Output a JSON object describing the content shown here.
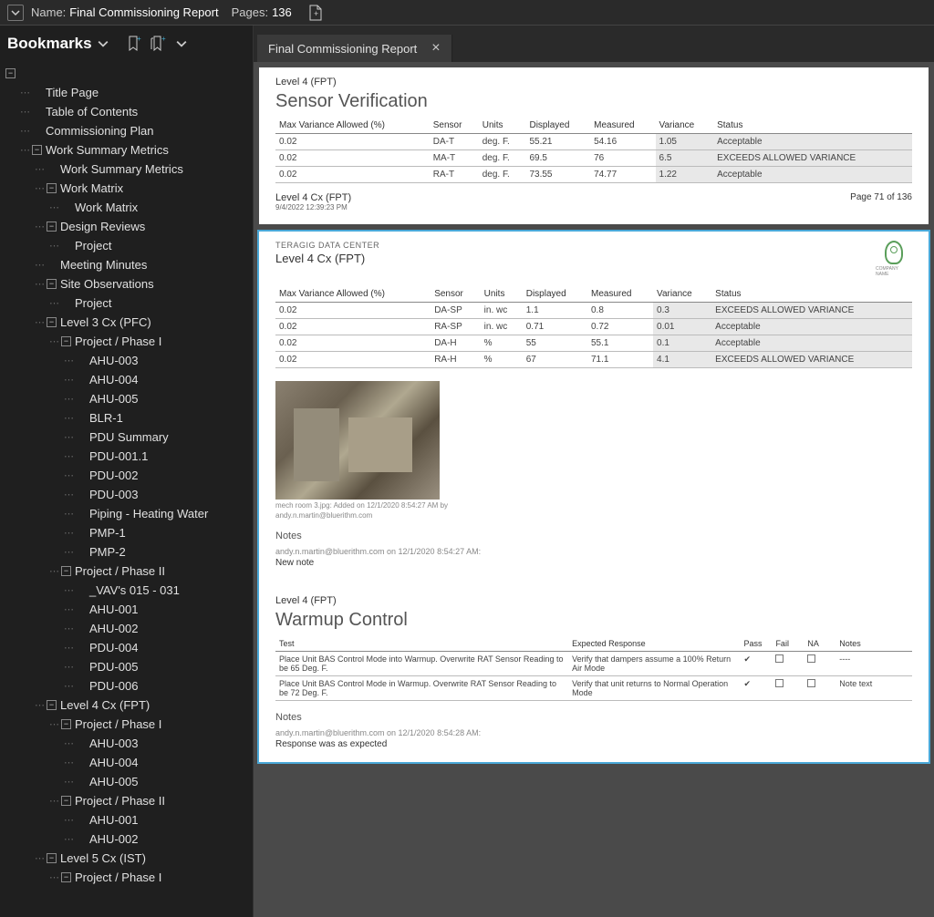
{
  "topbar": {
    "name_label": "Name:",
    "name_value": "Final Commissioning Report",
    "pages_label": "Pages:",
    "pages_value": "136"
  },
  "sidebar": {
    "title": "Bookmarks",
    "tree": [
      {
        "indent": 0,
        "exp": "-",
        "label": ""
      },
      {
        "indent": 1,
        "exp": "",
        "label": "Title Page"
      },
      {
        "indent": 1,
        "exp": "",
        "label": "Table of Contents"
      },
      {
        "indent": 1,
        "exp": "",
        "label": "Commissioning Plan"
      },
      {
        "indent": 1,
        "exp": "-",
        "label": "Work Summary Metrics"
      },
      {
        "indent": 2,
        "exp": "",
        "label": "Work Summary Metrics"
      },
      {
        "indent": 2,
        "exp": "-",
        "label": "Work Matrix"
      },
      {
        "indent": 3,
        "exp": "",
        "label": "Work Matrix"
      },
      {
        "indent": 2,
        "exp": "-",
        "label": "Design Reviews"
      },
      {
        "indent": 3,
        "exp": "",
        "label": "Project"
      },
      {
        "indent": 2,
        "exp": "",
        "label": "Meeting Minutes"
      },
      {
        "indent": 2,
        "exp": "-",
        "label": "Site Observations"
      },
      {
        "indent": 3,
        "exp": "",
        "label": "Project"
      },
      {
        "indent": 2,
        "exp": "-",
        "label": "Level 3 Cx (PFC)"
      },
      {
        "indent": 3,
        "exp": "-",
        "label": "Project / Phase I"
      },
      {
        "indent": 4,
        "exp": "",
        "label": "AHU-003"
      },
      {
        "indent": 4,
        "exp": "",
        "label": "AHU-004"
      },
      {
        "indent": 4,
        "exp": "",
        "label": "AHU-005"
      },
      {
        "indent": 4,
        "exp": "",
        "label": "BLR-1"
      },
      {
        "indent": 4,
        "exp": "",
        "label": "PDU Summary"
      },
      {
        "indent": 4,
        "exp": "",
        "label": "PDU-001.1"
      },
      {
        "indent": 4,
        "exp": "",
        "label": "PDU-002"
      },
      {
        "indent": 4,
        "exp": "",
        "label": "PDU-003"
      },
      {
        "indent": 4,
        "exp": "",
        "label": "Piping - Heating Water"
      },
      {
        "indent": 4,
        "exp": "",
        "label": "PMP-1"
      },
      {
        "indent": 4,
        "exp": "",
        "label": "PMP-2"
      },
      {
        "indent": 3,
        "exp": "-",
        "label": "Project / Phase II"
      },
      {
        "indent": 4,
        "exp": "",
        "label": "_VAV's 015 - 031"
      },
      {
        "indent": 4,
        "exp": "",
        "label": "AHU-001"
      },
      {
        "indent": 4,
        "exp": "",
        "label": "AHU-002"
      },
      {
        "indent": 4,
        "exp": "",
        "label": "PDU-004"
      },
      {
        "indent": 4,
        "exp": "",
        "label": "PDU-005"
      },
      {
        "indent": 4,
        "exp": "",
        "label": "PDU-006"
      },
      {
        "indent": 2,
        "exp": "-",
        "label": "Level 4 Cx (FPT)"
      },
      {
        "indent": 3,
        "exp": "-",
        "label": "Project / Phase I"
      },
      {
        "indent": 4,
        "exp": "",
        "label": "AHU-003"
      },
      {
        "indent": 4,
        "exp": "",
        "label": "AHU-004"
      },
      {
        "indent": 4,
        "exp": "",
        "label": "AHU-005"
      },
      {
        "indent": 3,
        "exp": "-",
        "label": "Project / Phase II"
      },
      {
        "indent": 4,
        "exp": "",
        "label": "AHU-001"
      },
      {
        "indent": 4,
        "exp": "",
        "label": "AHU-002"
      },
      {
        "indent": 2,
        "exp": "-",
        "label": "Level 5 Cx (IST)"
      },
      {
        "indent": 3,
        "exp": "-",
        "label": "Project / Phase I"
      }
    ]
  },
  "tab": {
    "title": "Final Commissioning Report"
  },
  "page1": {
    "level": "Level 4 (FPT)",
    "title": "Sensor Verification",
    "headers": [
      "Max Variance Allowed (%)",
      "Sensor",
      "Units",
      "Displayed",
      "Measured",
      "Variance",
      "Status"
    ],
    "rows": [
      [
        "0.02",
        "DA-T",
        "deg. F.",
        "55.21",
        "54.16",
        "1.05",
        "Acceptable"
      ],
      [
        "0.02",
        "MA-T",
        "deg. F.",
        "69.5",
        "76",
        "6.5",
        "EXCEEDS ALLOWED VARIANCE"
      ],
      [
        "0.02",
        "RA-T",
        "deg. F.",
        "73.55",
        "74.77",
        "1.22",
        "Acceptable"
      ]
    ],
    "footer_title": "Level 4 Cx (FPT)",
    "footer_date": "9/4/2022 12:39:23 PM",
    "footer_page": "Page 71 of 136"
  },
  "page2": {
    "org": "TERAGIG DATA CENTER",
    "level": "Level 4 Cx (FPT)",
    "logo_text": "COMPANY NAME",
    "headers": [
      "Max Variance Allowed (%)",
      "Sensor",
      "Units",
      "Displayed",
      "Measured",
      "Variance",
      "Status"
    ],
    "rows": [
      [
        "0.02",
        "DA-SP",
        "in. wc",
        "1.1",
        "0.8",
        "0.3",
        "EXCEEDS ALLOWED VARIANCE"
      ],
      [
        "0.02",
        "RA-SP",
        "in. wc",
        "0.71",
        "0.72",
        "0.01",
        "Acceptable"
      ],
      [
        "0.02",
        "DA-H",
        "%",
        "55",
        "55.1",
        "0.1",
        "Acceptable"
      ],
      [
        "0.02",
        "RA-H",
        "%",
        "67",
        "71.1",
        "4.1",
        "EXCEEDS ALLOWED VARIANCE"
      ]
    ],
    "photo_cap1": "mech room 3.jpg: Added on 12/1/2020 8:54:27 AM by",
    "photo_cap2": "andy.n.martin@bluerithm.com",
    "notes_label": "Notes",
    "note_meta": "andy.n.martin@bluerithm.com on 12/1/2020 8:54:27 AM:",
    "note_text": "New note",
    "section2_level": "Level 4 (FPT)",
    "section2_title": "Warmup Control",
    "wheaders": [
      "Test",
      "Expected Response",
      "Pass",
      "Fail",
      "NA",
      "Notes"
    ],
    "wrows": [
      [
        "Place Unit BAS Control Mode into Warmup. Overwrite RAT Sensor Reading to be 65 Deg. F.",
        "Verify that dampers assume a 100% Return Air Mode",
        "✔",
        "",
        "",
        "----"
      ],
      [
        "Place Unit BAS Control Mode in Warmup. Overwrite RAT Sensor Reading to be 72 Deg. F.",
        "Verify that unit returns to Normal Operation Mode",
        "✔",
        "",
        "",
        "Note text"
      ]
    ],
    "notes2_label": "Notes",
    "note2_meta": "andy.n.martin@bluerithm.com on 12/1/2020 8:54:28 AM:",
    "note2_text": "Response was as expected"
  }
}
